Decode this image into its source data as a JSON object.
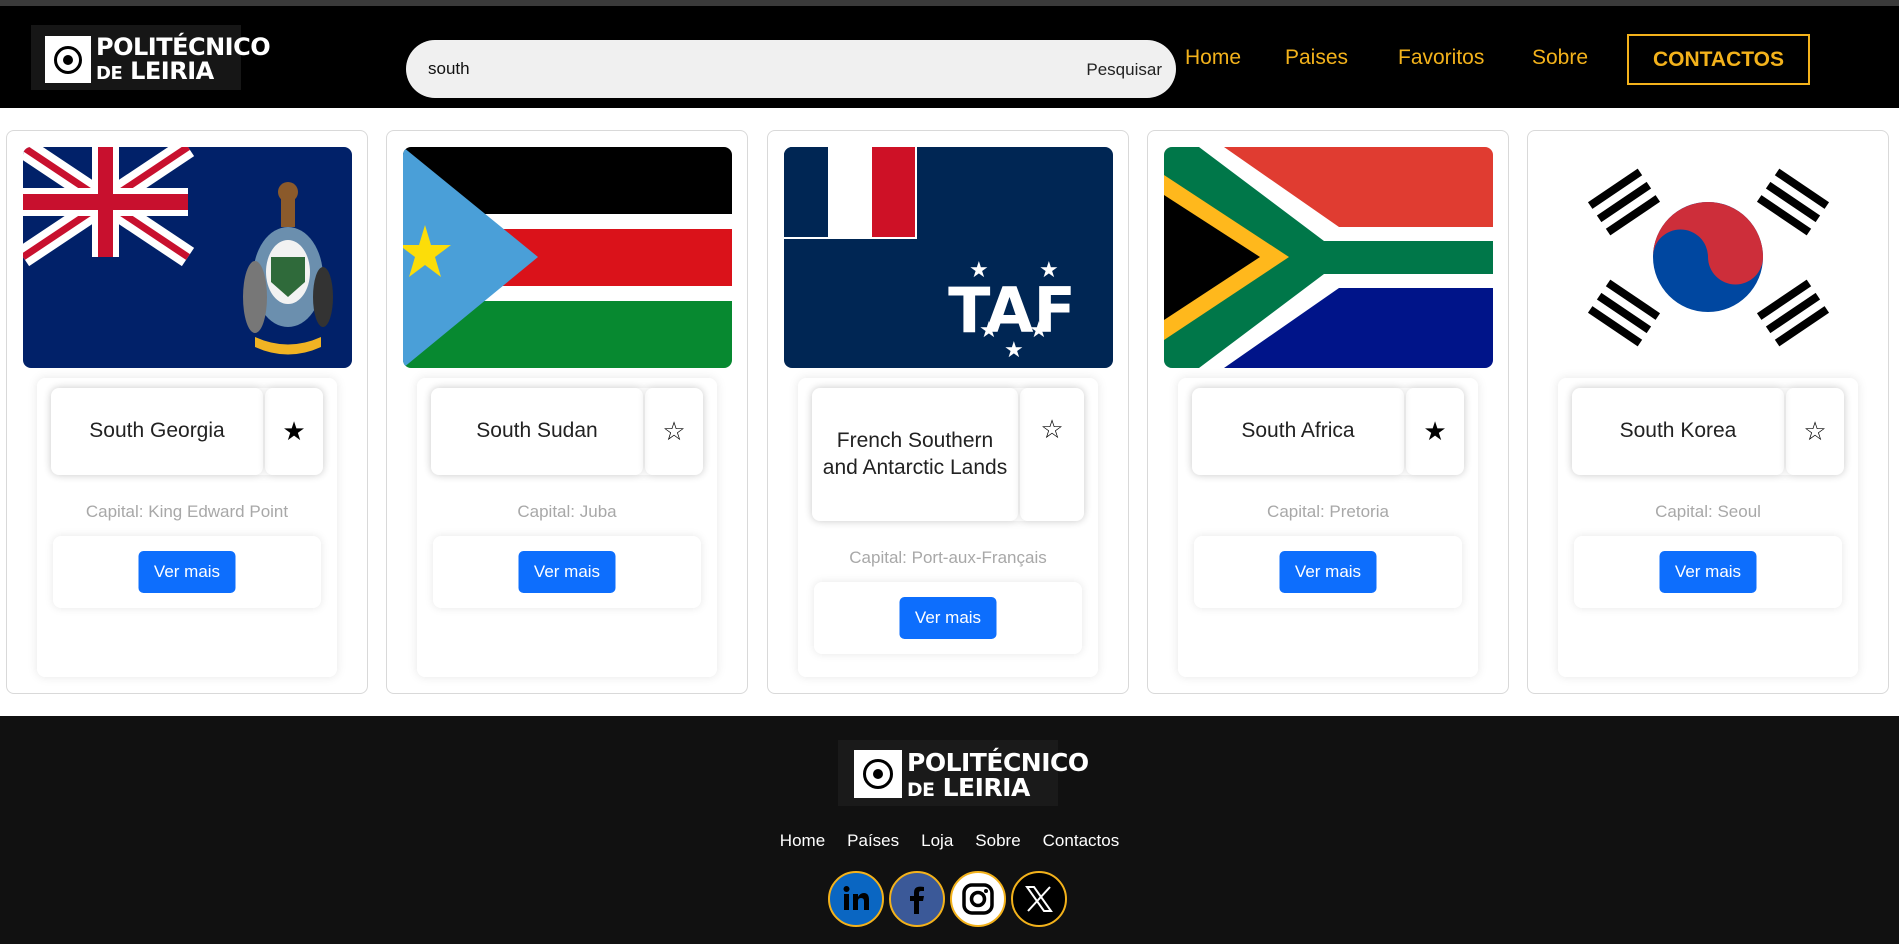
{
  "header": {
    "logo": {
      "line1": "POLITÉCNICO",
      "line2_small": "DE",
      "line2": "LEIRIA"
    },
    "search": {
      "value": "south",
      "button": "Pesquisar"
    },
    "nav": [
      "Home",
      "Paises",
      "Favoritos",
      "Sobre"
    ],
    "contact": "CONTACTOS"
  },
  "accent_color": "#f3b21b",
  "button_color": "#0d6efd",
  "cards": [
    {
      "name": "South Georgia",
      "favorite": true,
      "capital": "Capital: King Edward Point",
      "more": "Ver mais"
    },
    {
      "name": "South Sudan",
      "favorite": false,
      "capital": "Capital: Juba",
      "more": "Ver mais"
    },
    {
      "name": "French Southern and Antarctic Lands",
      "favorite": false,
      "capital": "Capital: Port-aux-Français",
      "more": "Ver mais"
    },
    {
      "name": "South Africa",
      "favorite": true,
      "capital": "Capital: Pretoria",
      "more": "Ver mais"
    },
    {
      "name": "South Korea",
      "favorite": false,
      "capital": "Capital: Seoul",
      "more": "Ver mais"
    }
  ],
  "footer": {
    "logo": {
      "line1": "POLITÉCNICO",
      "line2_small": "DE",
      "line2": "LEIRIA"
    },
    "links": [
      "Home",
      "Países",
      "Loja",
      "Sobre",
      "Contactos"
    ],
    "socials": [
      "linkedin-icon",
      "facebook-icon",
      "instagram-icon",
      "x-icon"
    ]
  }
}
